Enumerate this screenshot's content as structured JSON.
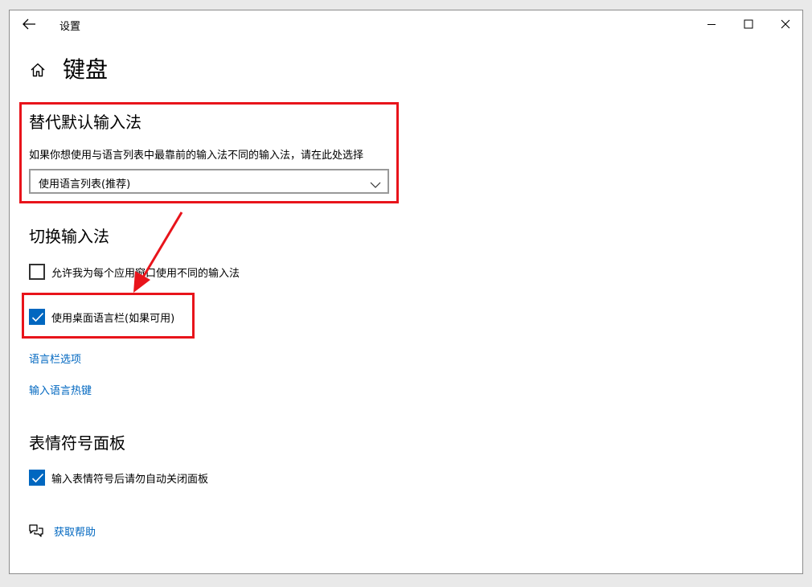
{
  "window": {
    "title": "设置",
    "controls": {
      "minimize": "minimize-icon",
      "maximize": "maximize-icon",
      "close": "close-icon"
    }
  },
  "page": {
    "title": "键盘"
  },
  "override_input": {
    "heading": "替代默认输入法",
    "description": "如果你想使用与语言列表中最靠前的输入法不同的输入法，请在此处选择",
    "dropdown_value": "使用语言列表(推荐)"
  },
  "switch_input": {
    "heading": "切换输入法",
    "per_app_label": "允许我为每个应用窗口使用不同的输入法",
    "per_app_checked": false,
    "desktop_bar_label": "使用桌面语言栏(如果可用)",
    "desktop_bar_checked": true,
    "language_bar_options": "语言栏选项",
    "input_hotkeys": "输入语言热键"
  },
  "emoji_panel": {
    "heading": "表情符号面板",
    "auto_close_label": "输入表情符号后请勿自动关闭面板",
    "auto_close_checked": true
  },
  "help": {
    "label": "获取帮助"
  },
  "colors": {
    "accent": "#0067c0",
    "annotation": "#e8141b"
  }
}
